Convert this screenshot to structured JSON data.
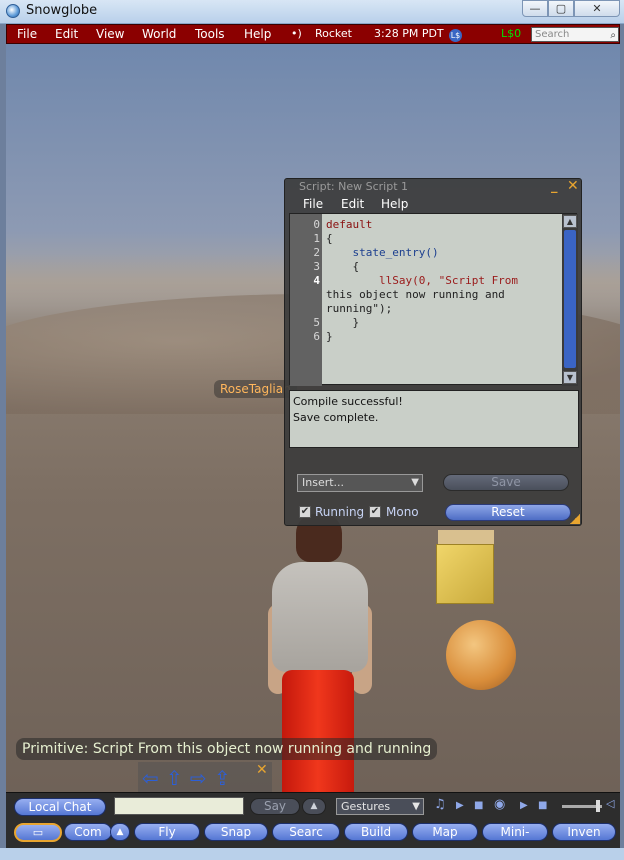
{
  "window": {
    "title": "Snowglobe",
    "min_label": "—",
    "max_label": "▢",
    "close_label": "✕"
  },
  "menubar": {
    "items": [
      "File",
      "Edit",
      "View",
      "World",
      "Tools",
      "Help"
    ],
    "sound_icon": "•)",
    "region": "Rocket",
    "time": "3:28 PM PDT",
    "ls_icon": "L$",
    "balance": "L$0",
    "search_placeholder": "Search"
  },
  "scene": {
    "avatar_name": "RoseTaglian"
  },
  "script_editor": {
    "title": "Script: New Script 1",
    "menu": [
      "File",
      "Edit",
      "Help"
    ],
    "line_numbers": [
      "0",
      "1",
      "2",
      "3",
      "4",
      "5",
      "6"
    ],
    "code_lines": [
      "default",
      "{",
      "    state_entry()",
      "    {",
      "        llSay(0, \"Script From",
      "this object now running and",
      "running\");",
      "    }",
      "}"
    ],
    "output_lines": [
      "Compile successful!",
      "Save complete."
    ],
    "insert_label": "Insert...",
    "save_label": "Save",
    "reset_label": "Reset",
    "running_label": "Running",
    "running_checked": true,
    "mono_label": "Mono",
    "mono_checked": true
  },
  "chat": {
    "message": "Primitive: Script From this object now running and running"
  },
  "chatbar": {
    "local_chat": "Local Chat",
    "say": "Say",
    "gestures": "Gestures"
  },
  "toolbar": {
    "buttons": [
      "Com",
      "Fly",
      "Snap",
      "Searc",
      "Build",
      "Map",
      "Mini-",
      "Inven"
    ]
  },
  "colors": {
    "menubar_bg": "#8b0000",
    "accent_orange": "#e8a530",
    "button_blue": "#5577d4"
  }
}
